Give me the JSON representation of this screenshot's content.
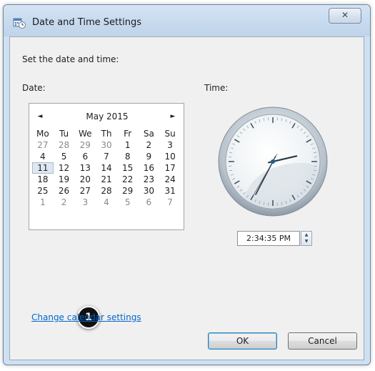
{
  "window": {
    "title": "Date and Time Settings",
    "close_label": "✕"
  },
  "header": {
    "instruction": "Set the date and time:",
    "date_label": "Date:",
    "time_label": "Time:"
  },
  "calendar": {
    "month_title": "May 2015",
    "prev_label": "◄",
    "next_label": "►",
    "weekdays": [
      "Mo",
      "Tu",
      "We",
      "Th",
      "Fr",
      "Sa",
      "Su"
    ],
    "weeks": [
      [
        "27",
        "28",
        "29",
        "30",
        "1",
        "2",
        "3"
      ],
      [
        "4",
        "5",
        "6",
        "7",
        "8",
        "9",
        "10"
      ],
      [
        "11",
        "12",
        "13",
        "14",
        "15",
        "16",
        "17"
      ],
      [
        "18",
        "19",
        "20",
        "21",
        "22",
        "23",
        "24"
      ],
      [
        "25",
        "26",
        "27",
        "28",
        "29",
        "30",
        "31"
      ],
      [
        "1",
        "2",
        "3",
        "4",
        "5",
        "6",
        "7"
      ]
    ],
    "selected_day": "11"
  },
  "clock": {
    "hour": 2,
    "minute": 34,
    "second": 35
  },
  "time_field": {
    "value": "2:34:35 PM"
  },
  "annotation": {
    "step": "1"
  },
  "links": {
    "change_calendar": "Change calendar settings"
  },
  "buttons": {
    "ok": "OK",
    "cancel": "Cancel"
  },
  "colors": {
    "link": "#0066cc",
    "titlebar": "#c6d9ee",
    "client": "#f0f0f0"
  }
}
